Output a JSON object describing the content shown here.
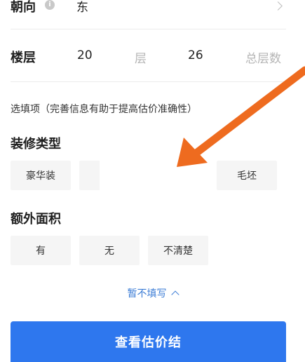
{
  "orientation": {
    "label": "朝向",
    "value": "东"
  },
  "floor": {
    "label": "楼层",
    "current": "20",
    "current_unit": "层",
    "total": "26",
    "total_unit": "总层数"
  },
  "hint": "选填项（完善信息有助于提高估价准确性）",
  "decoration": {
    "title": "装修类型",
    "options": [
      "豪华装",
      "毛坯"
    ]
  },
  "extra_area": {
    "title": "额外面积",
    "options": [
      "有",
      "无",
      "不清楚"
    ]
  },
  "collapse_toggle": "暂不填写",
  "cta_label": "查看估价结",
  "colors": {
    "accent": "#2e77ee",
    "link": "#3a7bd5",
    "arrow": "#ee6b1f",
    "option_bg": "#f5f5f5"
  }
}
